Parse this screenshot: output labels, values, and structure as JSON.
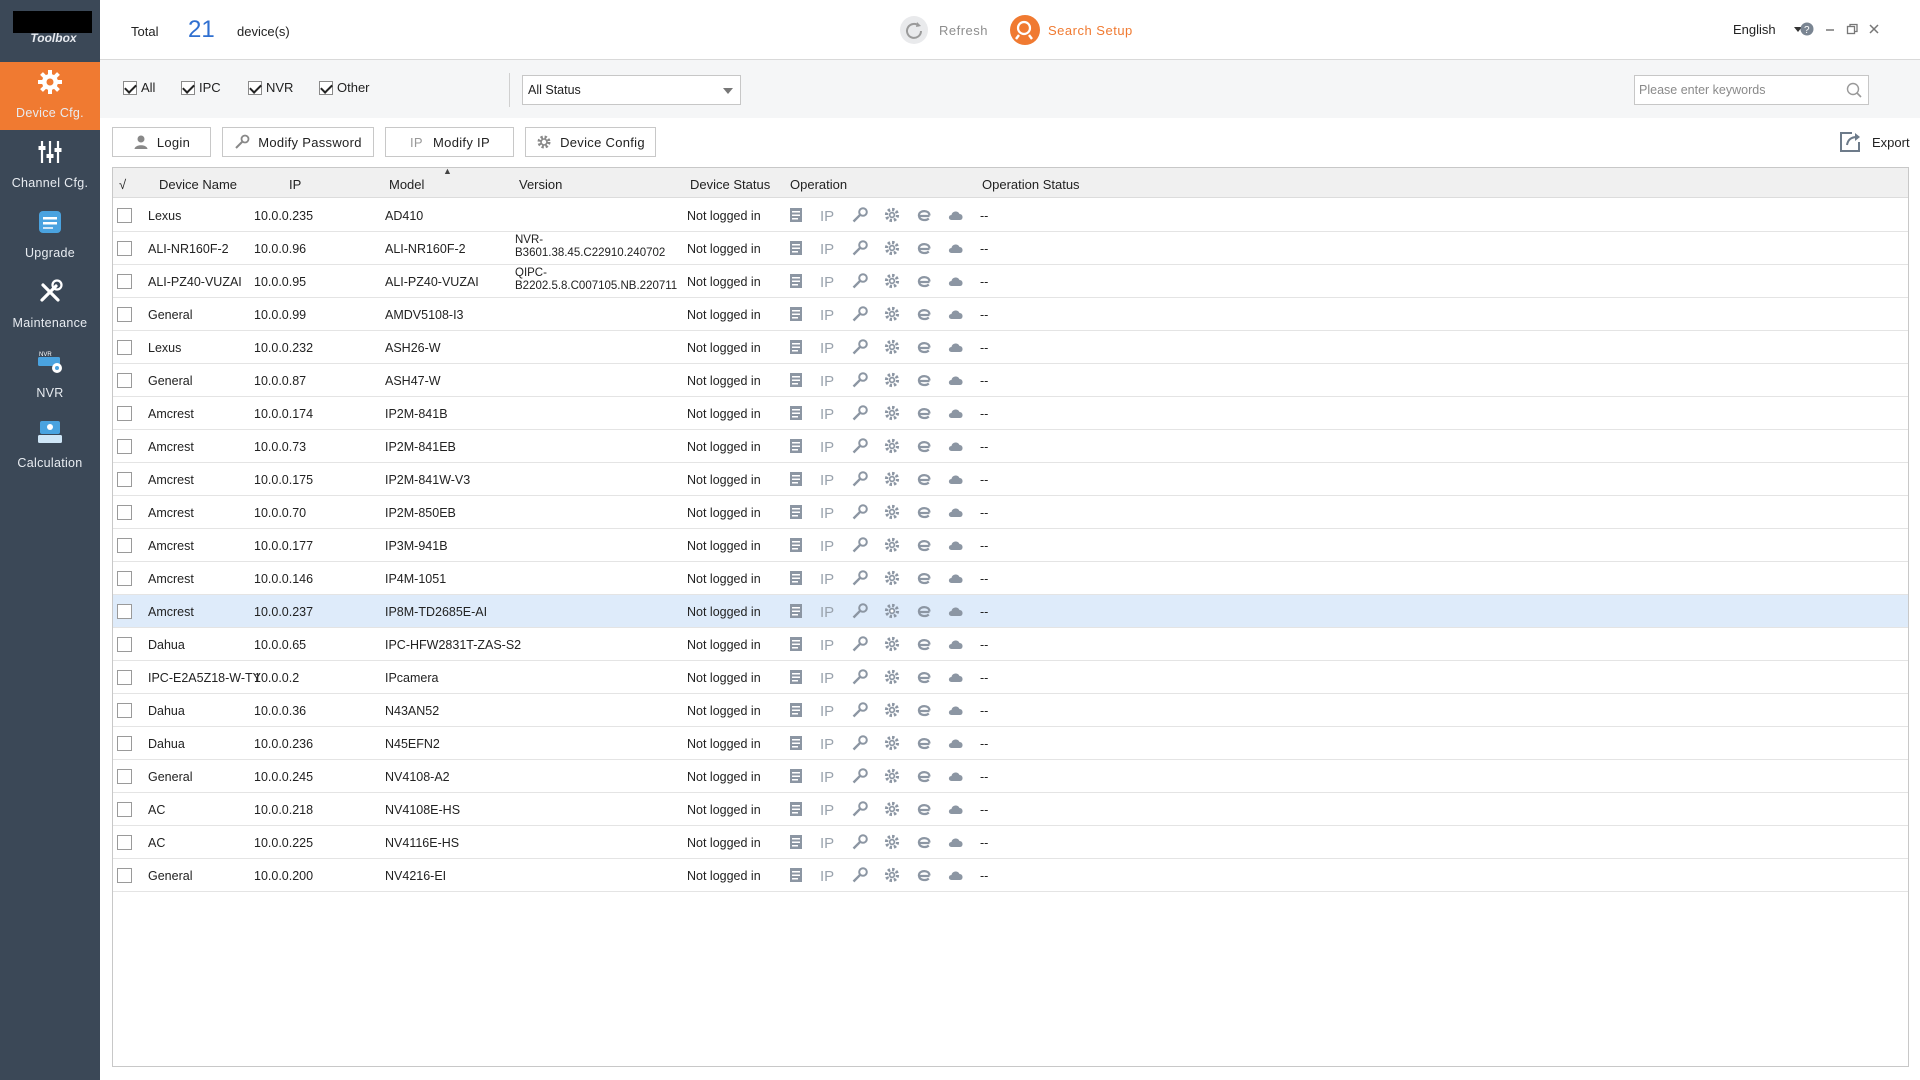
{
  "app": {
    "logo_text": "Toolbox"
  },
  "sidebar": {
    "items": [
      {
        "label": "Device Cfg.",
        "icon": "gear-icon",
        "active": true
      },
      {
        "label": "Channel Cfg.",
        "icon": "sliders-icon",
        "active": false
      },
      {
        "label": "Upgrade",
        "icon": "upgrade-icon",
        "active": false
      },
      {
        "label": "Maintenance",
        "icon": "tools-icon",
        "active": false
      },
      {
        "label": "NVR",
        "icon": "nvr-icon",
        "active": false
      },
      {
        "label": "Calculation",
        "icon": "calculator-icon",
        "active": false
      }
    ]
  },
  "header": {
    "total_label": "Total",
    "total_count": "21",
    "devices_label": "device(s)",
    "refresh_label": "Refresh",
    "search_setup_label": "Search Setup",
    "language": "English"
  },
  "filters": {
    "all": "All",
    "ipc": "IPC",
    "nvr": "NVR",
    "other": "Other",
    "status_selected": "All Status",
    "search_placeholder": "Please enter keywords"
  },
  "actions": {
    "login": "Login",
    "modify_password": "Modify Password",
    "modify_ip": "Modify IP",
    "device_config": "Device Config",
    "export": "Export"
  },
  "table": {
    "columns": {
      "check": "√",
      "device_name": "Device Name",
      "ip": "IP",
      "model": "Model",
      "version": "Version",
      "device_status": "Device Status",
      "operation": "Operation",
      "operation_status": "Operation Status"
    },
    "selected_row": 12,
    "rows": [
      {
        "name": "Lexus",
        "ip": "10.0.0.235",
        "model": "AD410",
        "version": "",
        "status": "Not logged in",
        "op_status": "--"
      },
      {
        "name": "ALI-NR160F-2",
        "ip": "10.0.0.96",
        "model": "ALI-NR160F-2",
        "version": "NVR-B3601.38.45.C22910.240702",
        "status": "Not logged in",
        "op_status": "--"
      },
      {
        "name": "ALI-PZ40-VUZAI",
        "ip": "10.0.0.95",
        "model": "ALI-PZ40-VUZAI",
        "version": "QIPC-B2202.5.8.C007105.NB.220711",
        "status": "Not logged in",
        "op_status": "--"
      },
      {
        "name": "General",
        "ip": "10.0.0.99",
        "model": "AMDV5108-I3",
        "version": "",
        "status": "Not logged in",
        "op_status": "--"
      },
      {
        "name": "Lexus",
        "ip": "10.0.0.232",
        "model": "ASH26-W",
        "version": "",
        "status": "Not logged in",
        "op_status": "--"
      },
      {
        "name": "General",
        "ip": "10.0.0.87",
        "model": "ASH47-W",
        "version": "",
        "status": "Not logged in",
        "op_status": "--"
      },
      {
        "name": "Amcrest",
        "ip": "10.0.0.174",
        "model": "IP2M-841B",
        "version": "",
        "status": "Not logged in",
        "op_status": "--"
      },
      {
        "name": "Amcrest",
        "ip": "10.0.0.73",
        "model": "IP2M-841EB",
        "version": "",
        "status": "Not logged in",
        "op_status": "--"
      },
      {
        "name": "Amcrest",
        "ip": "10.0.0.175",
        "model": "IP2M-841W-V3",
        "version": "",
        "status": "Not logged in",
        "op_status": "--"
      },
      {
        "name": "Amcrest",
        "ip": "10.0.0.70",
        "model": "IP2M-850EB",
        "version": "",
        "status": "Not logged in",
        "op_status": "--"
      },
      {
        "name": "Amcrest",
        "ip": "10.0.0.177",
        "model": "IP3M-941B",
        "version": "",
        "status": "Not logged in",
        "op_status": "--"
      },
      {
        "name": "Amcrest",
        "ip": "10.0.0.146",
        "model": "IP4M-1051",
        "version": "",
        "status": "Not logged in",
        "op_status": "--"
      },
      {
        "name": "Amcrest",
        "ip": "10.0.0.237",
        "model": "IP8M-TD2685E-AI",
        "version": "",
        "status": "Not logged in",
        "op_status": "--"
      },
      {
        "name": "Dahua",
        "ip": "10.0.0.65",
        "model": "IPC-HFW2831T-ZAS-S2",
        "version": "",
        "status": "Not logged in",
        "op_status": "--"
      },
      {
        "name": "IPC-E2A5Z18-W-TY",
        "ip": "10.0.0.2",
        "model": "IPcamera",
        "version": "",
        "status": "Not logged in",
        "op_status": "--"
      },
      {
        "name": "Dahua",
        "ip": "10.0.0.36",
        "model": "N43AN52",
        "version": "",
        "status": "Not logged in",
        "op_status": "--"
      },
      {
        "name": "Dahua",
        "ip": "10.0.0.236",
        "model": "N45EFN2",
        "version": "",
        "status": "Not logged in",
        "op_status": "--"
      },
      {
        "name": "General",
        "ip": "10.0.0.245",
        "model": "NV4108-A2",
        "version": "",
        "status": "Not logged in",
        "op_status": "--"
      },
      {
        "name": "AC",
        "ip": "10.0.0.218",
        "model": "NV4108E-HS",
        "version": "",
        "status": "Not logged in",
        "op_status": "--"
      },
      {
        "name": "AC",
        "ip": "10.0.0.225",
        "model": "NV4116E-HS",
        "version": "",
        "status": "Not logged in",
        "op_status": "--"
      },
      {
        "name": "General",
        "ip": "10.0.0.200",
        "model": "NV4216-EI",
        "version": "",
        "status": "Not logged in",
        "op_status": "--"
      }
    ],
    "operation_icons": [
      "details-icon",
      "ip-icon",
      "key-icon",
      "gear-icon",
      "browser-icon",
      "cloud-icon"
    ],
    "ip_icon_text": "IP"
  },
  "colors": {
    "accent": "#f07a31",
    "sidebar": "#3b4857",
    "count": "#2f6fd0",
    "selected_row": "#deebfa"
  }
}
